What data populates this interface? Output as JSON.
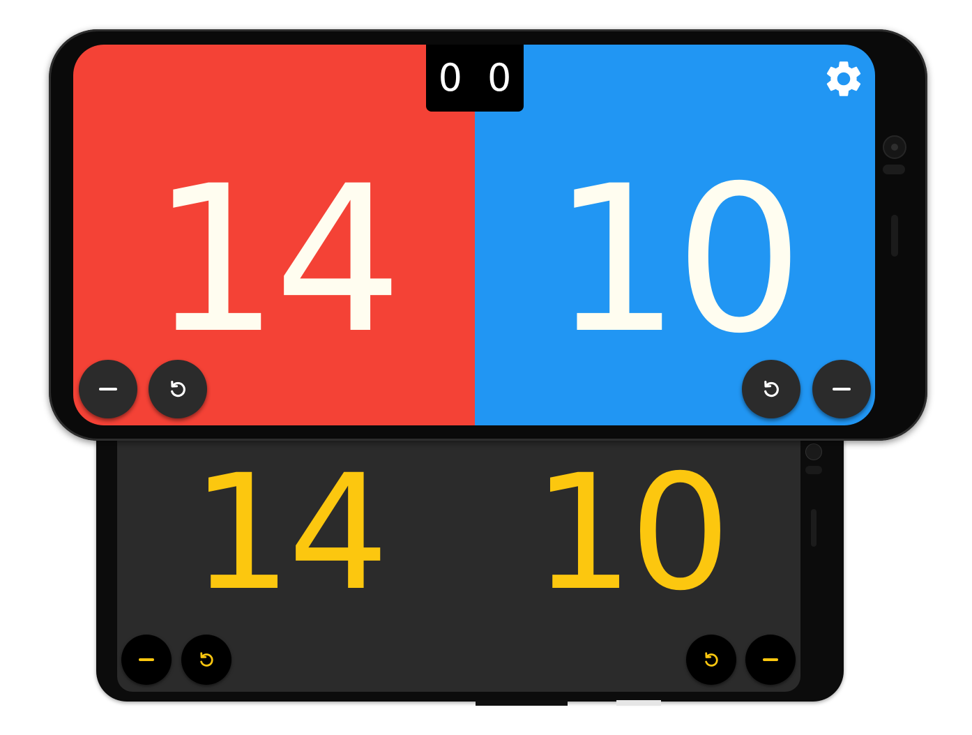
{
  "back_phone": {
    "theme": "dark",
    "colors": {
      "background": "#2b2b2b",
      "accent": "#fcc70f",
      "button": "#000000"
    },
    "left": {
      "score": "14"
    },
    "right": {
      "score": "10"
    },
    "buttons": {
      "left_minus_icon": "minus-icon",
      "left_undo_icon": "undo-icon",
      "right_undo_icon": "undo-icon",
      "right_minus_icon": "minus-icon"
    }
  },
  "front_phone": {
    "theme": "color",
    "colors": {
      "left_team": "#f44236",
      "right_team": "#2196f3",
      "score_text": "#fffdf0",
      "button": "#2b2b2b"
    },
    "sets": {
      "left": "0",
      "right": "0"
    },
    "left": {
      "score": "14"
    },
    "right": {
      "score": "10"
    },
    "settings_icon": "gear-icon",
    "buttons": {
      "left_minus_icon": "minus-icon",
      "left_undo_icon": "undo-icon",
      "right_undo_icon": "undo-icon",
      "right_minus_icon": "minus-icon"
    }
  }
}
